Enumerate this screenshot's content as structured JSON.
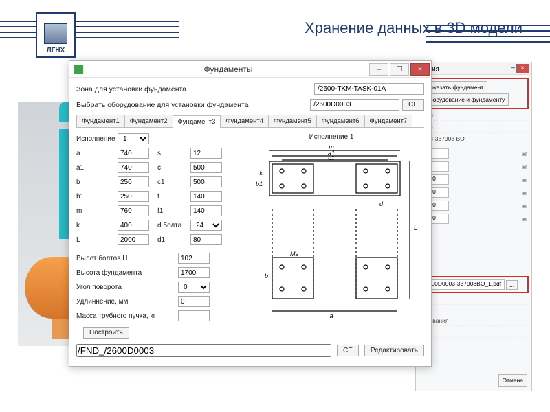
{
  "header": {
    "logo_text": "ЛГНХ",
    "page_title": "Хранение данных в 3D модели"
  },
  "bg_window": {
    "title": "ования",
    "btn_show_foundation": "Показать фундамент",
    "btn_goto": "оборудование и фундаменту",
    "stub1": "0003",
    "stub2": "0003",
    "stub3": "0003-337908 BO",
    "values": [
      "400",
      "170",
      "1200",
      "1550",
      "3320",
      "3230"
    ],
    "unit": "кг",
    "pdf": "2600D0003-337908BO_1.pdf",
    "slash": "В/Ж",
    "label_r": "рудования",
    "label_e": "ии",
    "cancel": "Отмена"
  },
  "dlg": {
    "title": "Фундаменты",
    "zone_label": "Зона для установки фундамента",
    "zone_value": "/2600-TKM-TASK-01A",
    "equip_label": "Выбрать оборудование для установки фундамента",
    "equip_value": "/2600D0003",
    "ce": "CE",
    "tabs": [
      "Фундамент1",
      "Фундамент2",
      "Фундамент3",
      "Фундамент4",
      "Фундамент5",
      "Фундамент6",
      "Фундамент7"
    ],
    "active_tab": 2,
    "exec_label": "Исполнение",
    "exec_value": "1",
    "params": [
      {
        "l": "a",
        "v": "740",
        "l2": "s",
        "v2": "12"
      },
      {
        "l": "a1",
        "v": "740",
        "l2": "c",
        "v2": "500"
      },
      {
        "l": "b",
        "v": "250",
        "l2": "c1",
        "v2": "500"
      },
      {
        "l": "b1",
        "v": "250",
        "l2": "f",
        "v2": "140"
      },
      {
        "l": "m",
        "v": "760",
        "l2": "f1",
        "v2": "140"
      },
      {
        "l": "k",
        "v": "400",
        "l2": "d болта",
        "v2": "24"
      },
      {
        "l": "L",
        "v": "2000",
        "l2": "d1",
        "v2": "80"
      }
    ],
    "long_params": [
      {
        "l": "Вылет болтов H",
        "v": "102"
      },
      {
        "l": "Высота фундамента",
        "v": "1700"
      },
      {
        "l": "Угол поворота",
        "v": "0",
        "sel": true
      },
      {
        "l": "Удлиннение, мм",
        "v": "0"
      },
      {
        "l": "Масса трубного пучка, кг",
        "v": ""
      }
    ],
    "diagram_title": "Исполнение 1",
    "dim_m": "m",
    "dim_a1": "a1",
    "dim_c1": "c1",
    "dim_k": "k",
    "dim_b1": "b1",
    "dim_d": "d",
    "dim_L": "L",
    "dim_a": "a",
    "dim_b": "b",
    "dim_s": "Мs",
    "build_btn": "Построить",
    "path_value": "/FND_/2600D0003",
    "edit_btn": "Редактировать"
  }
}
